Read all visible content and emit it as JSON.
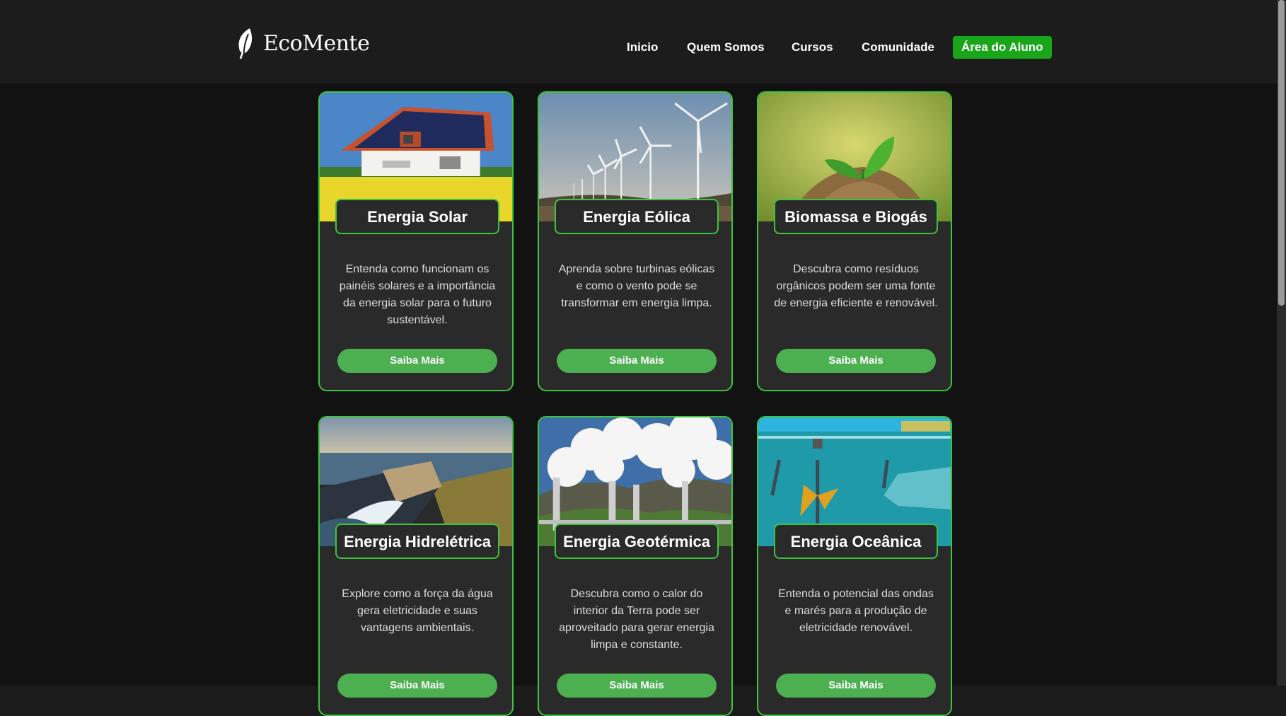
{
  "header": {
    "logo_text": "EcoMente",
    "nav": [
      {
        "label": "Inicio"
      },
      {
        "label": "Quem Somos"
      },
      {
        "label": "Cursos"
      },
      {
        "label": "Comunidade"
      },
      {
        "label": "Área do Aluno"
      }
    ]
  },
  "cards": [
    {
      "title": "Energia Solar",
      "description": "Entenda como funcionam os painéis solares e a importância da energia solar para o futuro sustentável.",
      "button": "Saiba Mais"
    },
    {
      "title": "Energia Eólica",
      "description": "Aprenda sobre turbinas eólicas e como o vento pode se transformar em energia limpa.",
      "button": "Saiba Mais"
    },
    {
      "title": "Biomassa e Biogás",
      "description": "Descubra como resíduos orgânicos podem ser uma fonte de energia eficiente e renovável.",
      "button": "Saiba Mais"
    },
    {
      "title": "Energia Hidrelétrica",
      "description": "Explore como a força da água gera eletricidade e suas vantagens ambientais.",
      "button": "Saiba Mais"
    },
    {
      "title": "Energia Geotérmica",
      "description": "Descubra como o calor do interior da Terra pode ser aproveitado para gerar energia limpa e constante.",
      "button": "Saiba Mais"
    },
    {
      "title": "Energia Oceânica",
      "description": "Entenda o potencial das ondas e marés para a produção de eletricidade renovável.",
      "button": "Saiba Mais"
    }
  ],
  "colors": {
    "accent": "#3ec43e",
    "button": "#4caf50",
    "cta": "#1aa61a",
    "background": "#121212"
  }
}
